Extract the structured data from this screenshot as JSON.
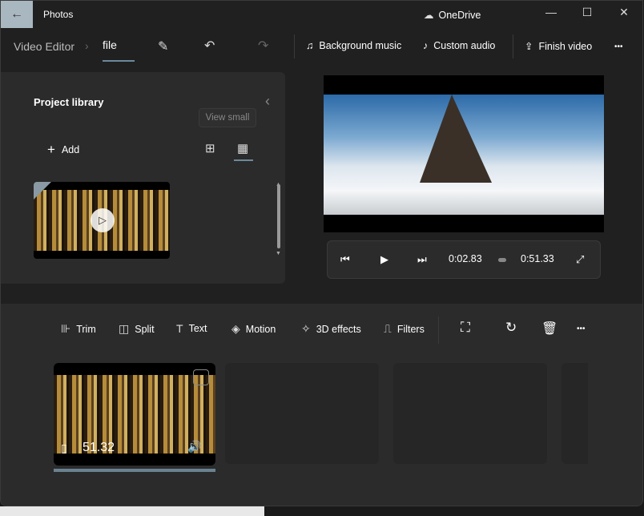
{
  "titlebar": {
    "app_title": "Photos",
    "cloud_label": "OneDrive",
    "minimize": "—",
    "maximize": "☐",
    "close": "✕",
    "back": "←"
  },
  "command_bar": {
    "breadcrumb": "Video Editor",
    "project_name": "file",
    "background_music": "Background music",
    "custom_audio": "Custom audio",
    "finish_video": "Finish video",
    "more": "•••"
  },
  "library": {
    "title": "Project library",
    "add_label": "Add",
    "tooltip": "View small",
    "collapse": "‹"
  },
  "player": {
    "current_time": "0:02.83",
    "total_time": "0:51.33"
  },
  "toolbar": {
    "items": [
      "Trim",
      "Split",
      "Text",
      "Motion",
      "3D effects",
      "Filters"
    ],
    "more": "•••"
  },
  "timeline": {
    "clip_duration": "51.32"
  },
  "colors": {
    "accent": "#6a8a9a",
    "back_button": "#a9b7c0"
  }
}
